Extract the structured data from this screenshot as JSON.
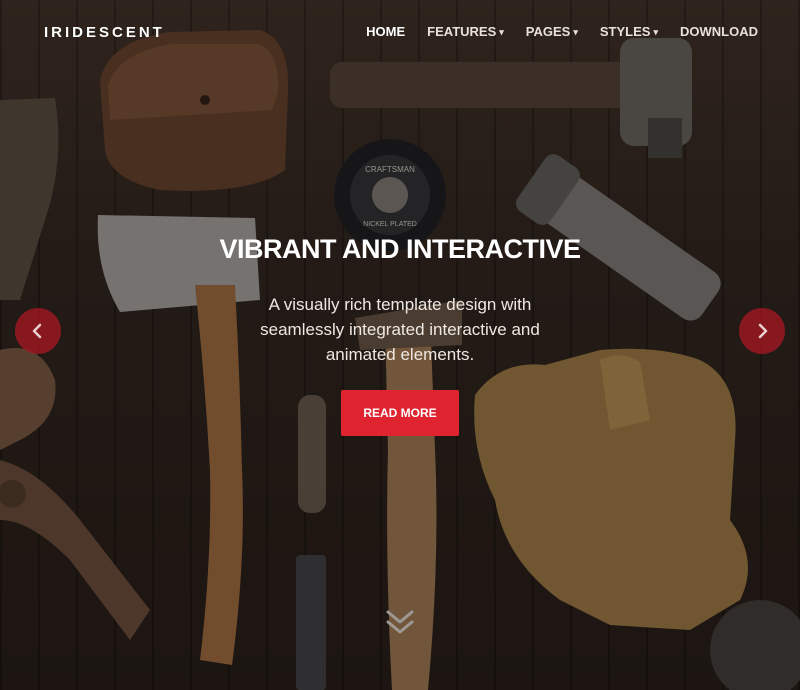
{
  "brand": {
    "logo_text": "IRIDESCENT"
  },
  "nav": {
    "items": [
      {
        "label": "HOME",
        "active": true,
        "has_dropdown": false
      },
      {
        "label": "FEATURES",
        "active": false,
        "has_dropdown": true
      },
      {
        "label": "PAGES",
        "active": false,
        "has_dropdown": true
      },
      {
        "label": "STYLES",
        "active": false,
        "has_dropdown": true
      },
      {
        "label": "DOWNLOAD",
        "active": false,
        "has_dropdown": false
      }
    ]
  },
  "hero": {
    "headline": "VIBRANT AND INTERACTIVE",
    "subtitle": "A visually rich template design with seamlessly integrated interactive and animated elements.",
    "cta_label": "READ MORE",
    "tape_text_1": "CRAFTSMAN",
    "tape_text_2": "NICKEL PLATED"
  },
  "colors": {
    "accent": "#e0242f",
    "arrow_bg": "#aa1824",
    "text": "#ffffff"
  },
  "icons": {
    "prev": "chevron-left-icon",
    "next": "chevron-right-icon",
    "scroll": "double-chevron-down-icon",
    "dropdown": "chevron-down-icon"
  }
}
